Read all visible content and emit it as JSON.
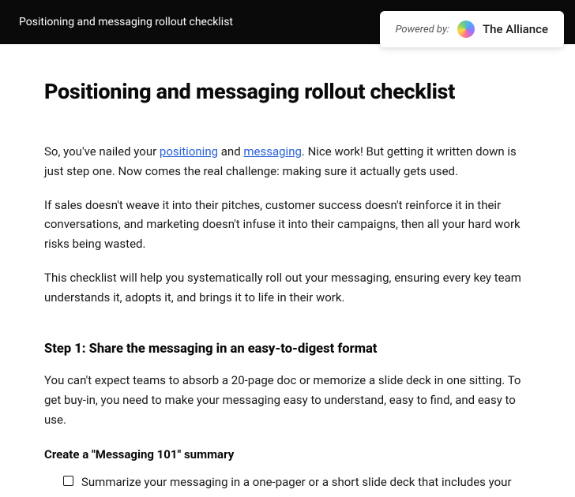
{
  "header": {
    "title": "Positioning and messaging rollout checklist",
    "powered_by_label": "Powered by:",
    "brand_name": "The Alliance"
  },
  "page": {
    "title": "Positioning and messaging rollout checklist",
    "intro_1_pre": "So, you've nailed your ",
    "intro_1_link1": "positioning",
    "intro_1_mid": " and ",
    "intro_1_link2": "messaging",
    "intro_1_post": ". Nice work! But getting it written down is just step one. Now comes the real challenge: making sure it actually gets used.",
    "intro_2": "If sales doesn't weave it into their pitches, customer success doesn't reinforce it in their conversations, and marketing doesn't infuse it into their campaigns, then all your hard work risks being wasted.",
    "intro_3": "This checklist will help you systematically roll out your messaging, ensuring every key team understands it, adopts it, and brings it to life in their work.",
    "step1_heading": "Step 1: Share the messaging in an easy-to-digest format",
    "step1_body": "You can't expect teams to absorb a 20-page doc or memorize a slide deck in one sitting. To get buy-in, you need to make your messaging easy to understand, easy to find, and easy to use.",
    "subsection1_heading": "Create a \"Messaging 101\" summary",
    "checklist_item_1": "Summarize your messaging in a one-pager or a short slide deck that includes your"
  }
}
